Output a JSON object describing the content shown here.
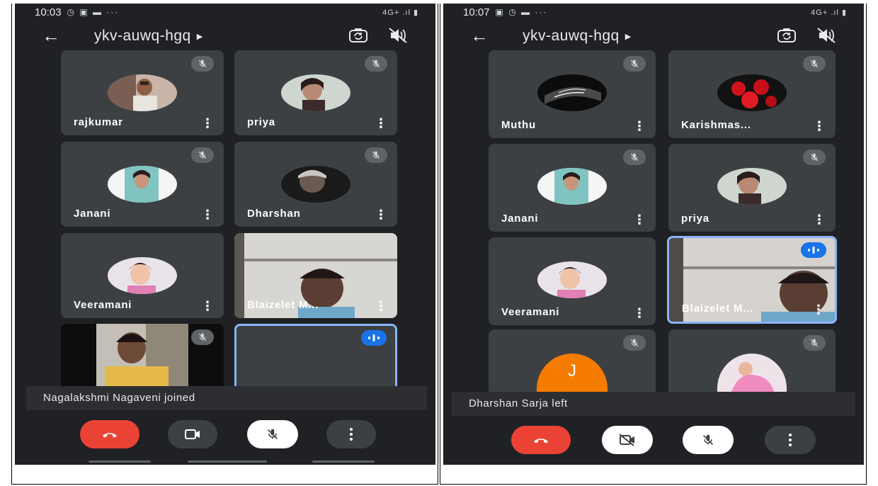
{
  "left": {
    "status": {
      "time": "10:03",
      "icons": "◷ ▣ ▬  ···",
      "network": "4G+ .ıl ▮"
    },
    "meeting_code": "ykv-auwq-hgq",
    "participants": [
      {
        "name": "rajkumar"
      },
      {
        "name": "priya"
      },
      {
        "name": "Janani"
      },
      {
        "name": "Dharshan"
      },
      {
        "name": "Veeramani"
      },
      {
        "name": "Blaizelet M..."
      },
      {
        "name": ""
      },
      {
        "name": ""
      }
    ],
    "toast": "Nagalakshmi Nagaveni joined"
  },
  "right": {
    "status": {
      "time": "10:07",
      "icons": "▣ ◷ ▬  ···",
      "network": "4G+ .ıl ▮"
    },
    "meeting_code": "ykv-auwq-hgq",
    "participants": [
      {
        "name": "Muthu"
      },
      {
        "name": "Karishmas..."
      },
      {
        "name": "Janani"
      },
      {
        "name": "priya"
      },
      {
        "name": "Veeramani"
      },
      {
        "name": "Blaizelet M..."
      },
      {
        "name": "",
        "initial": "J"
      },
      {
        "name": ""
      }
    ],
    "toast": "Dharshan Sarja left"
  },
  "icons": {
    "back": "back-arrow-icon",
    "switch_camera": "switch-camera-icon",
    "speaker_off": "speaker-off-icon",
    "mic_off": "mic-off-icon",
    "more": "more-vertical-icon",
    "end_call": "end-call-icon",
    "camera": "camera-icon",
    "camera_off": "camera-off-icon",
    "speaking": "speaking-indicator-icon"
  },
  "colors": {
    "background": "#202124",
    "tile": "#3c4043",
    "end_call": "#ea4335",
    "speaking_border": "#8ab4f8",
    "speaking_badge": "#1a73e8",
    "avatar_initial": "#f57c00"
  }
}
